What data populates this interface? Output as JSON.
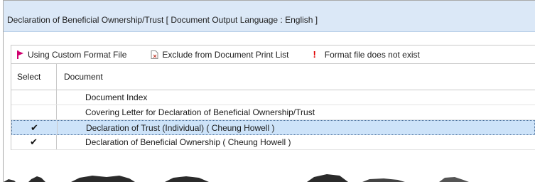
{
  "window": {
    "title": "Declaration of Beneficial Ownership/Trust [ Document Output Language : English ]"
  },
  "legend": {
    "custom_format": "Using Custom Format File",
    "exclude": "Exclude from Document Print List",
    "missing_symbol": "!",
    "missing": "Format file does not exist"
  },
  "columns": {
    "select": "Select",
    "document": "Document"
  },
  "rows": [
    {
      "checked": false,
      "check": "",
      "label": "Document Index"
    },
    {
      "checked": false,
      "check": "",
      "label": "Covering Letter for Declaration of Beneficial Ownership/Trust"
    },
    {
      "checked": true,
      "check": "✔",
      "label": "Declaration of Trust (Individual) ( Cheung Howell )"
    },
    {
      "checked": true,
      "check": "✔",
      "label": "Declaration of Beneficial Ownership ( Cheung Howell )"
    }
  ],
  "colors": {
    "title_bg": "#dbe8f7",
    "selected_row": "#cde3f9",
    "flag": "#d0006f",
    "error": "#e00000"
  }
}
